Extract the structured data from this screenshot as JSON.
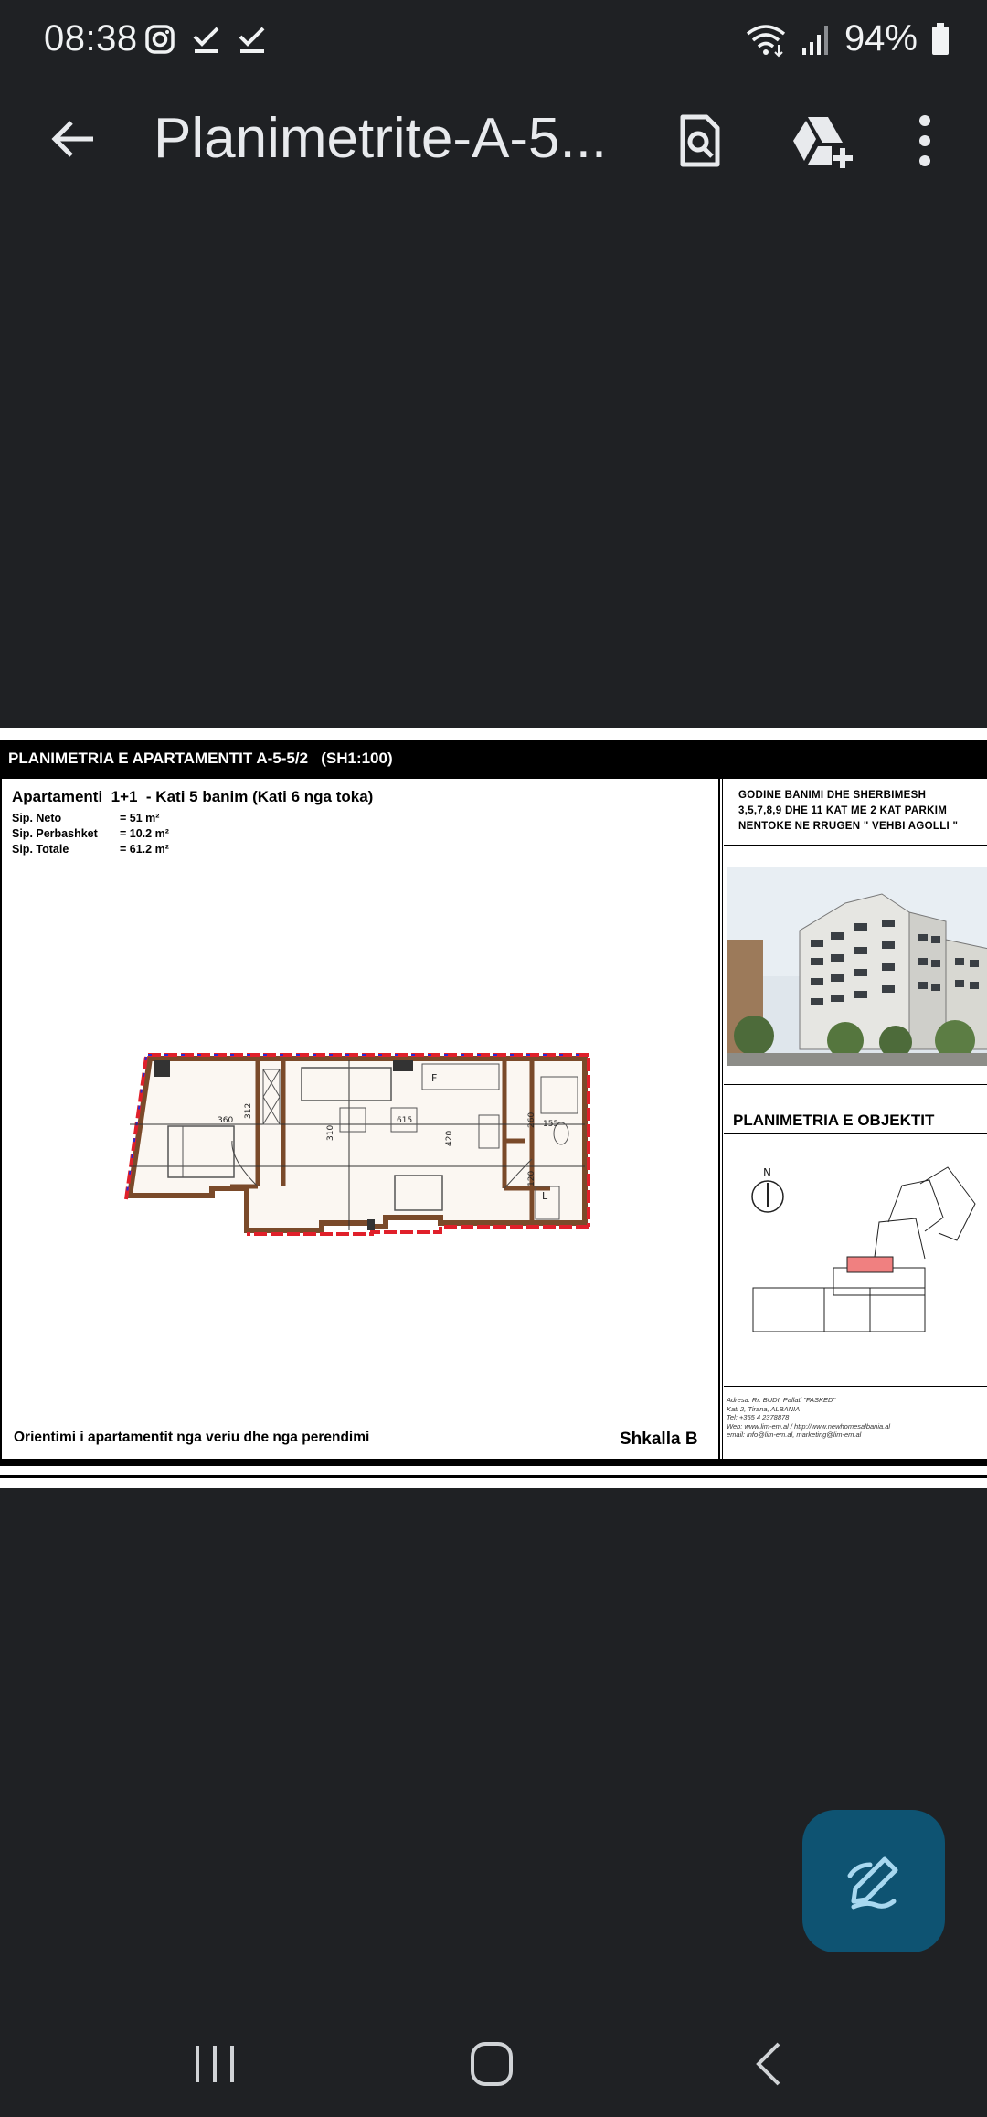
{
  "status_bar": {
    "time": "08:38",
    "battery": "94%",
    "left_icons": [
      "instagram-icon",
      "check-icon",
      "check-icon"
    ],
    "right_icons": [
      "wifi-icon",
      "signal-icon",
      "battery-icon"
    ]
  },
  "app_bar": {
    "title": "Planimetrite-A-5...",
    "actions": [
      "search-document-icon",
      "add-to-drive-icon",
      "more-vert-icon"
    ]
  },
  "document": {
    "header": "PLANIMETRIA E APARTAMENTIT A-5-5/2   (SH1:100)",
    "apartment_title": "Apartamenti  1+1  - Kati 5 banim (Kati 6 nga toka)",
    "areas": [
      {
        "label": "Sip. Neto",
        "value": "=  51    m²"
      },
      {
        "label": "Sip. Perbashket",
        "value": "=  10.2 m²"
      },
      {
        "label": "Sip. Totale",
        "value": "= 61.2 m²"
      }
    ],
    "plan_dims": [
      "360",
      "312",
      "310",
      "615",
      "420",
      "260",
      "155",
      "120"
    ],
    "plan_labels": [
      "F",
      "L"
    ],
    "building_info": [
      "GODINE BANIMI DHE SHERBIMESH",
      "3,5,7,8,9 DHE 11 KAT ME 2 KAT PARKIM",
      "NENTOKE NE RRUGEN \" VEHBI AGOLLI \""
    ],
    "objekt_title": "PLANIMETRIA E OBJEKTIT",
    "north_label": "N",
    "contact": [
      "Adresa: Rr. BUDI, Pallati \"FASKED\"",
      "Kati 2, Tirana, ALBANIA",
      "Tel: +355 4 2378878",
      "Web: www.lim-em.al / http://www.newhomesalbania.al",
      "email: info@lim-em.al, marketing@lim-em.al"
    ],
    "orientation": "Orientimi i apartamentit nga veriu dhe nga perendimi",
    "shkalla": "Shkalla B"
  },
  "fab": {
    "icon": "edit-pen-icon"
  },
  "nav_bar": {
    "buttons": [
      "recent-apps-icon",
      "home-icon",
      "back-nav-icon"
    ]
  },
  "colors": {
    "background": "#1f2124",
    "fab": "#0e5372",
    "plan_highlight": "#f08080"
  }
}
